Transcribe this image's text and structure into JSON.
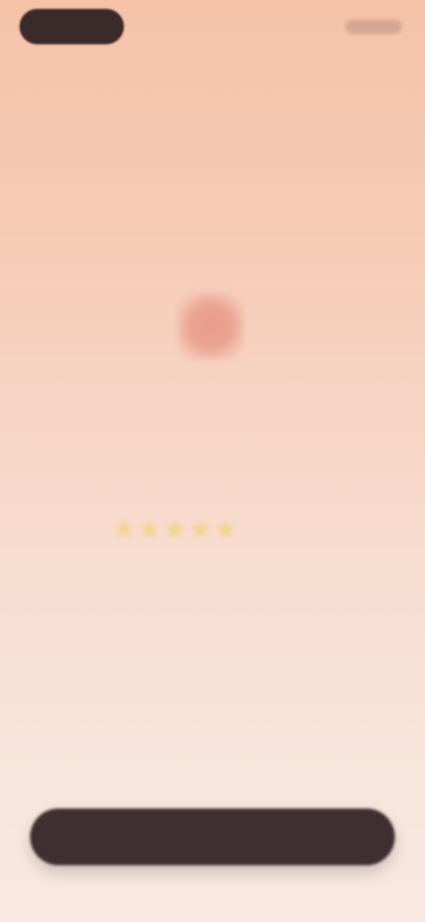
{
  "status_bar": {
    "left_pill": "",
    "right_icons": ""
  },
  "hero": {
    "icon": "heart-icon",
    "title": "",
    "rating": {
      "stars": 5,
      "value_label": "",
      "star_color": "#f2d48a"
    },
    "tagline": ""
  },
  "cta": {
    "label": "",
    "background": "#3f2f31"
  },
  "theme": {
    "background_top": "#f5c2a8",
    "background_bottom": "#f8e8e0",
    "icon_color": "#e89b8b"
  }
}
